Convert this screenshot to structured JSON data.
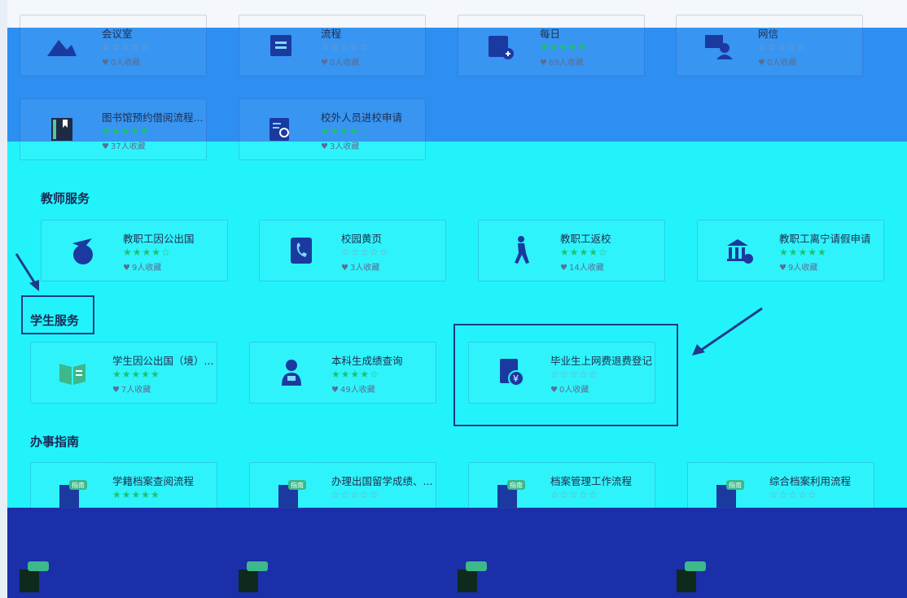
{
  "sections": {
    "teacher": "教师服务",
    "student": "学生服务",
    "guide": "办事指南"
  },
  "row1": [
    {
      "title": "会议室",
      "stars": "☆☆☆☆☆",
      "fav": "0人收藏",
      "on": false
    },
    {
      "title": "流程",
      "stars": "☆☆☆☆☆",
      "fav": "0人收藏",
      "on": false
    },
    {
      "title": "每日",
      "stars": "★★★★★",
      "fav": "69人收藏",
      "on": true
    },
    {
      "title": "网信",
      "stars": "☆☆☆☆☆",
      "fav": "0人收藏",
      "on": false
    }
  ],
  "row2": [
    {
      "title": "图书馆预约借阅流程...",
      "stars": "★★★★★",
      "fav": "37人收藏",
      "on": true
    },
    {
      "title": "校外人员进校申请",
      "stars": "★★★★☆",
      "fav": "3人收藏",
      "on": true
    }
  ],
  "teacher": [
    {
      "title": "教职工因公出国",
      "stars": "★★★★☆",
      "fav": "9人收藏",
      "on": true
    },
    {
      "title": "校园黄页",
      "stars": "☆☆☆☆☆",
      "fav": "3人收藏",
      "on": false
    },
    {
      "title": "教职工返校",
      "stars": "★★★★☆",
      "fav": "14人收藏",
      "on": true
    },
    {
      "title": "教职工离宁请假申请",
      "stars": "★★★★★",
      "fav": "9人收藏",
      "on": true
    }
  ],
  "student": [
    {
      "title": "学生因公出国（境）...",
      "stars": "★★★★★",
      "fav": "7人收藏",
      "on": true
    },
    {
      "title": "本科生成绩查询",
      "stars": "★★★★☆",
      "fav": "49人收藏",
      "on": true
    },
    {
      "title": "毕业生上网费退费登记",
      "stars": "☆☆☆☆☆",
      "fav": "0人收藏",
      "on": false
    }
  ],
  "guide": [
    {
      "title": "学籍档案查阅流程",
      "stars": "★★★★★",
      "fav": "",
      "on": true
    },
    {
      "title": "办理出国留学成绩、...",
      "stars": "☆☆☆☆☆",
      "fav": "",
      "on": false
    },
    {
      "title": "档案管理工作流程",
      "stars": "☆☆☆☆☆",
      "fav": "",
      "on": false
    },
    {
      "title": "综合档案利用流程",
      "stars": "☆☆☆☆☆",
      "fav": "",
      "on": false
    }
  ],
  "guide_badge": "指南",
  "heart": "♥",
  "colors": {
    "top_band": "#1a86f0",
    "cyan_band": "#22f3fb",
    "navy_band": "#1a2fa8",
    "stars_on": "#1cc26d",
    "highlight": "#1e3a8a"
  }
}
